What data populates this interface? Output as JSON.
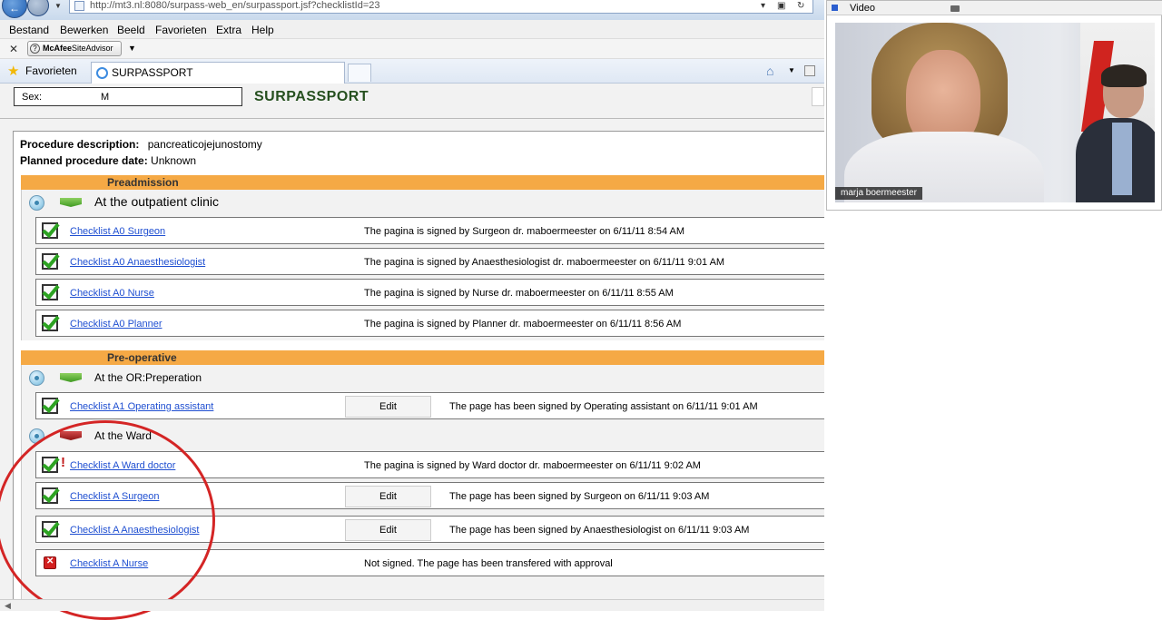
{
  "browser": {
    "url": "http://mt3.nl:8080/surpass-web_en/surpassport.jsf?checklistId=23",
    "menu": [
      "Bestand",
      "Bewerken",
      "Beeld",
      "Favorieten",
      "Extra",
      "Help"
    ],
    "mcafee_brand": "McAfee",
    "mcafee_product": "SiteAdvisor",
    "favorites_label": "Favorieten",
    "tab_title": "SURPASSPORT"
  },
  "app": {
    "title": "SURPASSPORT",
    "sex_label": "Sex:",
    "sex_value": "M",
    "procedure_label": "Procedure description:",
    "procedure_value": "pancreaticojejunostomy",
    "planned_label": "Planned procedure date:",
    "planned_value": "Unknown"
  },
  "phases": [
    {
      "name": "Preadmission",
      "steps": [
        {
          "label": "At the outpatient clinic",
          "flag_color": "#4aa52a",
          "checklists": [
            {
              "link": "Checklist A0 Surgeon",
              "status": "The pagina is signed by Surgeon dr. maboermeester on 6/11/11 8:54 AM"
            },
            {
              "link": "Checklist A0 Anaesthesiologist",
              "status": "The pagina is signed by Anaesthesiologist dr. maboermeester on 6/11/11 9:01 AM"
            },
            {
              "link": "Checklist A0 Nurse",
              "status": "The pagina is signed by Nurse dr. maboermeester on 6/11/11 8:55 AM"
            },
            {
              "link": "Checklist A0 Planner",
              "status": "The pagina is signed by Planner dr. maboermeester on 6/11/11 8:56 AM"
            }
          ]
        }
      ]
    },
    {
      "name": "Pre-operative",
      "steps": [
        {
          "label": "At the OR:Preperation",
          "flag_color": "#4aa52a",
          "checklists": [
            {
              "link": "Checklist A1 Operating assistant",
              "edit": "Edit",
              "status": "The page has been signed by Operating assistant on 6/11/11 9:01 AM"
            }
          ]
        },
        {
          "label": "At the Ward",
          "flag_color": "#b01f1f",
          "checklists": [
            {
              "link": "Checklist A Ward doctor",
              "status": "The pagina is signed by Ward doctor dr. maboermeester on 6/11/11 9:02 AM"
            },
            {
              "link": "Checklist A Surgeon",
              "edit": "Edit",
              "status": "The page has been signed by Surgeon on 6/11/11 9:03 AM"
            },
            {
              "link": "Checklist A Anaesthesiologist",
              "edit": "Edit",
              "status": "The page has been signed by Anaesthesiologist on 6/11/11 9:03 AM"
            },
            {
              "link": "Checklist A Nurse",
              "status": "Not signed. The page has been transfered with approval"
            }
          ]
        }
      ]
    }
  ],
  "video": {
    "title": "Video",
    "participant": "marja boermeester"
  },
  "colors": {
    "phase_header": "#f5a945",
    "title_green": "#26501f",
    "link_blue": "#1f4fd1",
    "annotation_red": "#d42525"
  }
}
